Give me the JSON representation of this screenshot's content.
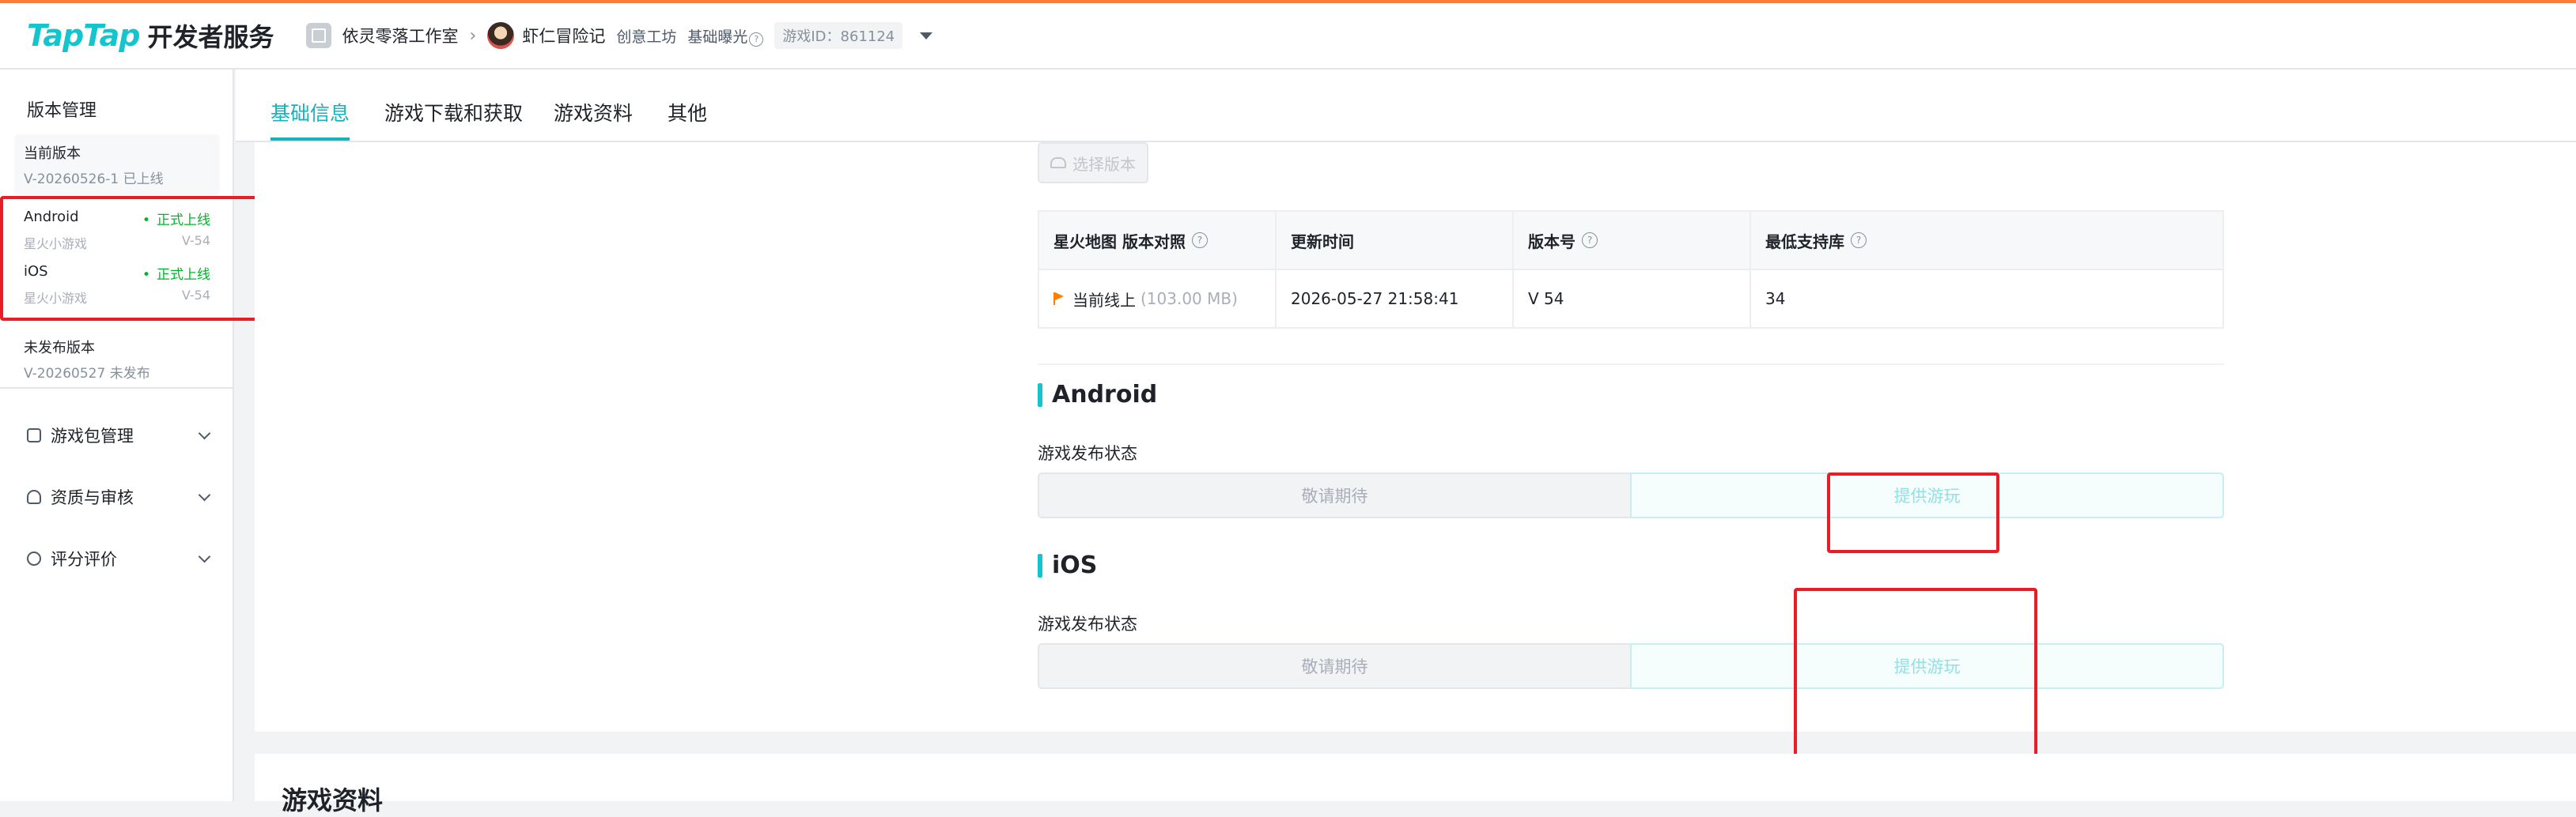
{
  "header": {
    "logo_main": "TapTap",
    "logo_sub": "开发者服务",
    "studio": "依灵零落工作室",
    "game_name": "虾仁冒险记",
    "tag_workshop": "创意工坊",
    "tag_exposure": "基础曝光",
    "game_id": "游戏ID：861124"
  },
  "sidebar": {
    "title": "版本管理",
    "current": {
      "label": "当前版本",
      "sub": "V-20260526-1 已上线"
    },
    "platforms": [
      {
        "name": "Android",
        "status": "正式上线",
        "sub": "星火小游戏",
        "version": "V-54"
      },
      {
        "name": "iOS",
        "status": "正式上线",
        "sub": "星火小游戏",
        "version": "V-54"
      }
    ],
    "unpublished": {
      "label": "未发布版本",
      "sub": "V-20260527 未发布"
    },
    "menu": [
      {
        "label": "游戏包管理"
      },
      {
        "label": "资质与审核"
      },
      {
        "label": "评分评价"
      }
    ]
  },
  "tabs": [
    "基础信息",
    "游戏下载和获取",
    "游戏资料",
    "其他"
  ],
  "select_version_button": "选择版本",
  "version_table": {
    "headers": [
      "星火地图 版本对照",
      "更新时间",
      "版本号",
      "最低支持库"
    ],
    "row": {
      "label": "当前线上",
      "size": "(103.00 MB)",
      "updated": "2026-05-27 21:58:41",
      "version": "V 54",
      "min_lib": "34"
    }
  },
  "android": {
    "title": "Android",
    "status_label": "游戏发布状态",
    "options": [
      "敬请期待",
      "提供游玩"
    ]
  },
  "ios": {
    "title": "iOS",
    "status_label": "游戏发布状态",
    "options": [
      "敬请期待",
      "提供游玩"
    ]
  },
  "next_section_title": "游戏资料",
  "colors": {
    "accent": "#15c5ce",
    "success": "#00b42a",
    "highlight": "#ea1c26",
    "topline": "#ff7a33"
  }
}
